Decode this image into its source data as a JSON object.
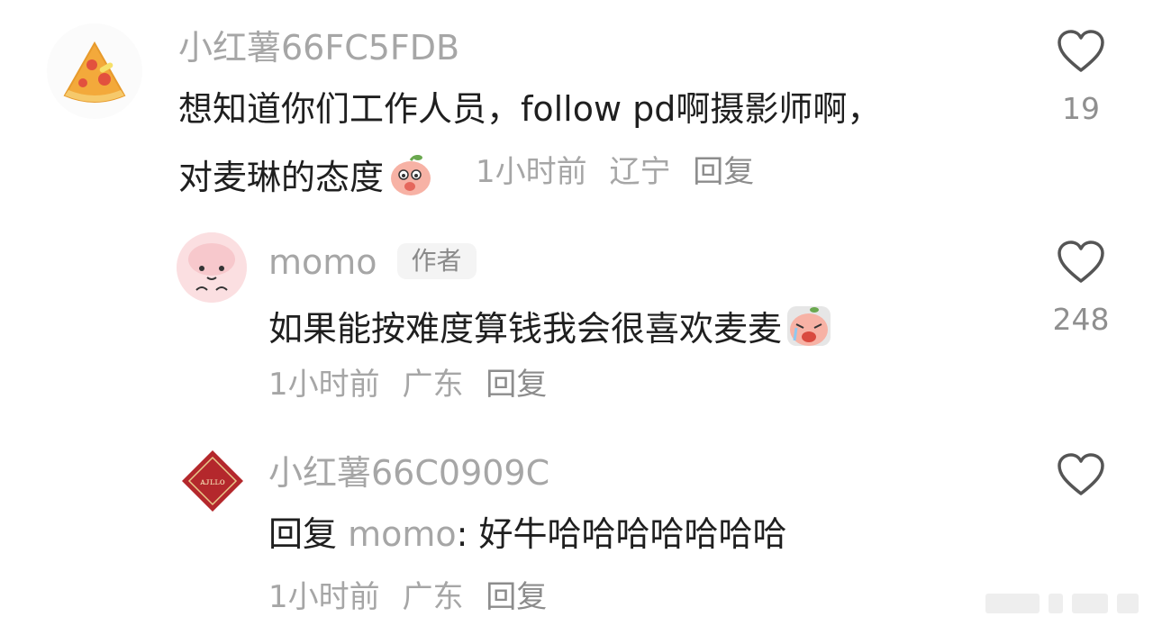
{
  "comments": [
    {
      "username": "小红薯66FC5FDB",
      "content_line1": "想知道你们工作人员，follow pd啊摄影师啊，",
      "content_line2": "对麦琳的态度",
      "time": "1小时前",
      "location": "辽宁",
      "reply_label": "回复",
      "likes": "19",
      "avatar_icon": "pizza-avatar"
    },
    {
      "username": "momo",
      "badge": "作者",
      "content": "如果能按难度算钱我会很喜欢麦麦",
      "time": "1小时前",
      "location": "广东",
      "reply_label": "回复",
      "likes": "248",
      "avatar_icon": "pink-face-avatar"
    },
    {
      "username": "小红薯66C0909C",
      "reply_prefix": "回复",
      "reply_to": "momo",
      "reply_text": ": 好牛哈哈哈哈哈哈哈",
      "time": "1小时前",
      "location": "广东",
      "reply_label": "回复",
      "avatar_icon": "red-diamond-avatar"
    }
  ],
  "colors": {
    "text_primary": "#1f1f1f",
    "text_secondary": "#a6a6a6",
    "icon_outline": "#8a8a8a"
  }
}
